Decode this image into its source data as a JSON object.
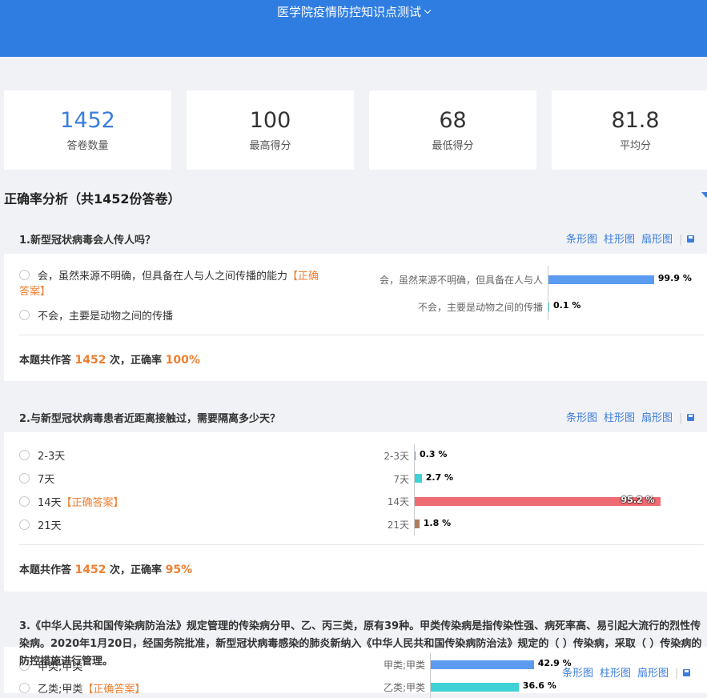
{
  "header": {
    "title": "医学院疫情防控知识点测试"
  },
  "stats": [
    {
      "value": "1452",
      "label": "答卷数量"
    },
    {
      "value": "100",
      "label": "最高得分"
    },
    {
      "value": "68",
      "label": "最低得分"
    },
    {
      "value": "81.8",
      "label": "平均分"
    }
  ],
  "section": {
    "title": "正确率分析（共1452份答卷）"
  },
  "actions": {
    "bar": "条形图",
    "column": "柱形图",
    "pie": "扇形图"
  },
  "summary_text": {
    "prefix": "本题共作答",
    "mid": "次，正确率"
  },
  "correct_tag": "【正确答案】",
  "colors": {
    "header": "#2f7de1",
    "accent": "#ee7f32",
    "link": "#3b7ddd"
  },
  "questions": [
    {
      "title": "1.新型冠状病毒会人传人吗？",
      "options": [
        {
          "text": "会，虽然来源不明确，但具备在人与人之间传播的能力",
          "correct": true,
          "correct_tag_a": "【正确",
          "correct_tag_b": "答案】"
        },
        {
          "text": "不会，主要是动物之间的传播",
          "correct": false
        }
      ],
      "count": "1452",
      "rate": "100%",
      "chart_data": {
        "type": "bar",
        "categories": [
          "会，虽然来源不明确，但具备在人与人之间传播的能力",
          "不会，主要是动物之间的传播"
        ],
        "axis_labels": [
          "会，虽然来源不明确，但具备在人与人",
          "不会，主要是动物之间的传播"
        ],
        "values": [
          99.9,
          0.1
        ],
        "value_labels": [
          "99.9 %",
          "0.1 %"
        ],
        "colors": [
          "#5b9bf0",
          "#3fd1d6"
        ]
      }
    },
    {
      "title": "2.与新型冠状病毒患者近距离接触过，需要隔离多少天？",
      "options": [
        {
          "text": "2-3天",
          "correct": false
        },
        {
          "text": "7天",
          "correct": false
        },
        {
          "text": "14天",
          "correct": true
        },
        {
          "text": "21天",
          "correct": false
        }
      ],
      "count": "1452",
      "rate": "95%",
      "chart_data": {
        "type": "bar",
        "categories": [
          "2-3天",
          "7天",
          "14天",
          "21天"
        ],
        "values": [
          0.3,
          2.7,
          95.2,
          1.8
        ],
        "value_labels": [
          "0.3 %",
          "2.7 %",
          "95.2 %",
          "1.8 %"
        ],
        "colors": [
          "#5b9bf0",
          "#3fd1d6",
          "#ef6b73",
          "#b07c5e"
        ]
      }
    },
    {
      "title": "3.《中华人民共和国传染病防治法》规定管理的传染病分甲、乙、丙三类，原有39种。甲类传染病是指传染性强、病死率高、易引起大流行的烈性传染病。2020年1月20日，经国务院批准，新型冠状病毒感染的肺炎新纳入《中华人民共和国传染病防治法》规定的（ ）传染病，采取（ ）传染病的防控措施进行管理。",
      "options": [
        {
          "text": "甲类;甲类",
          "correct": false
        },
        {
          "text": "乙类;甲类",
          "correct": true
        }
      ],
      "chart_data": {
        "type": "bar",
        "categories": [
          "甲类;甲类",
          "乙类;甲类"
        ],
        "values": [
          42.9,
          36.6
        ],
        "value_labels": [
          "42.9 %",
          "36.6 %"
        ],
        "colors": [
          "#5b9bf0",
          "#3fd1d6"
        ]
      }
    }
  ]
}
